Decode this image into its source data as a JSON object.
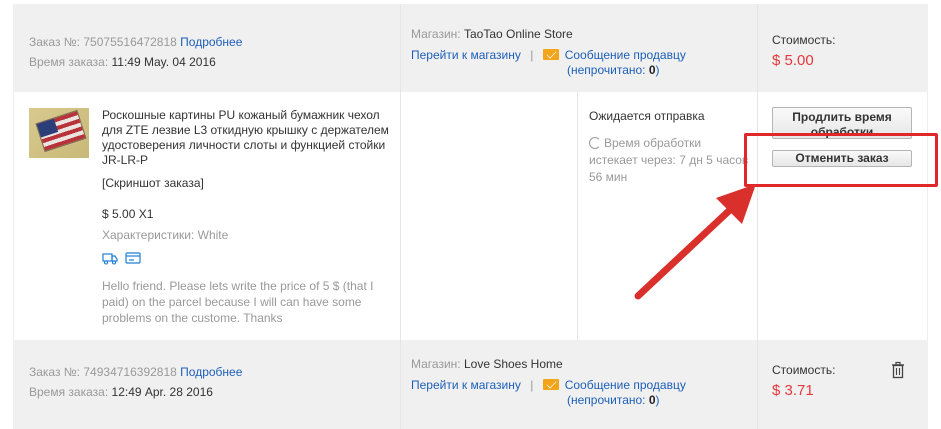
{
  "colors": {
    "link": "#1d5fb8",
    "price": "#e4393c",
    "highlight": "#e0282b",
    "header_bg": "#f0f0f0"
  },
  "order1": {
    "order_no_label": "Заказ №:",
    "order_no": "75075516472818",
    "details_link": "Подробнее",
    "time_label": "Время заказа:",
    "time": "11:49 May. 04 2016",
    "store_label": "Магазин:",
    "store_name": "TaoTao Online Store",
    "go_to_store": "Перейти к магазину",
    "separator": "|",
    "message_seller": "Сообщение продавцу",
    "unread_open": "(непрочитано: ",
    "unread_count": "0",
    "unread_close": ")",
    "cost_label": "Стоимость:",
    "cost": "$ 5.00"
  },
  "item1": {
    "title": "Роскошные картины PU кожаный бумажник чехол для ZTE лезвие L3 откидную крышку с держателем удостоверения личности слоты и функцией стойки JR-LR-P",
    "screenshot_link": "[Скриншот заказа]",
    "price_qty": "$ 5.00 X1",
    "characteristics": "Характеристики: White",
    "note_line1": "Hello friend. Please lets write the price of 5 $ (that I",
    "note_line2": "paid) on the parcel because I will can have some",
    "note_line3": "problems on the custome. Thanks",
    "status": "Ожидается отправка",
    "processing_line1": "Время обработки",
    "processing_line2": "истекает через: 7 дн 5 часов",
    "processing_line3": "56 мин",
    "extend_button": "Продлить время обработки",
    "cancel_button": "Отменить заказ",
    "icons": [
      "truck-icon",
      "card-icon"
    ]
  },
  "order2": {
    "order_no_label": "Заказ №:",
    "order_no": "74934716392818",
    "details_link": "Подробнее",
    "time_label": "Время заказа:",
    "time": "12:49 Apr. 28 2016",
    "store_label": "Магазин:",
    "store_name": "Love Shoes Home",
    "go_to_store": "Перейти к магазину",
    "separator": "|",
    "message_seller": "Сообщение продавцу",
    "unread_open": "(непрочитано: ",
    "unread_count": "0",
    "unread_close": ")",
    "cost_label": "Стоимость:",
    "cost": "$ 3.71"
  }
}
